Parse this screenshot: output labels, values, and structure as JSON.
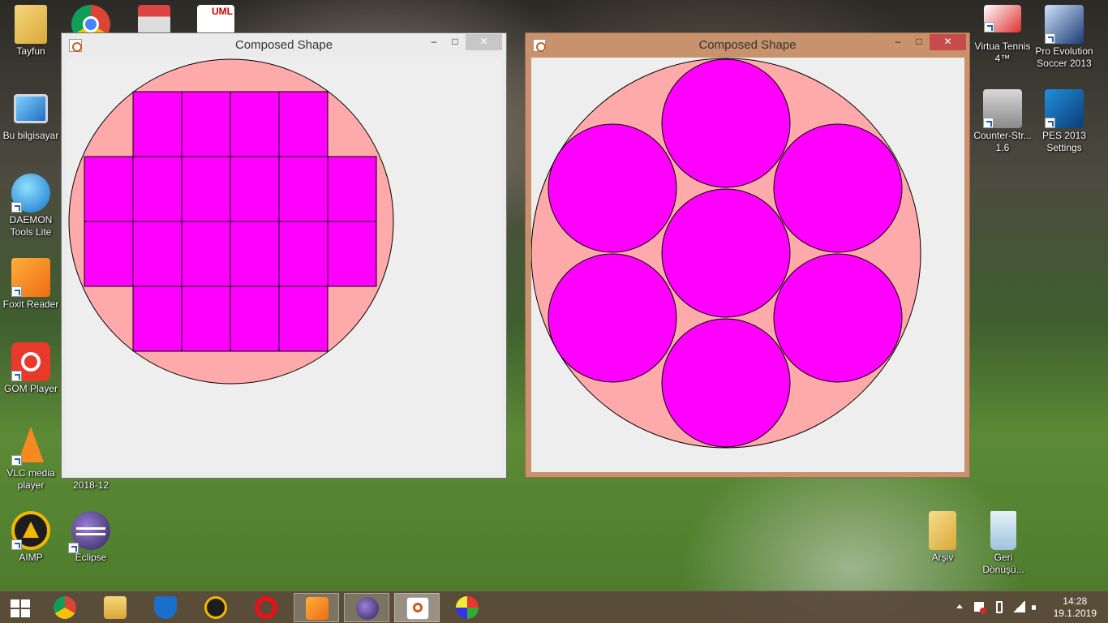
{
  "desktop": {
    "left_icons": [
      {
        "label": "Tayfun",
        "icon": "user-folder-icon"
      },
      {
        "label": "Bu bilgisayar",
        "icon": "computer-icon"
      },
      {
        "label": "DAEMON\nTools Lite",
        "icon": "daemon-tools-icon"
      },
      {
        "label": "Foxit Reader",
        "icon": "foxit-reader-icon"
      },
      {
        "label": "GOM Player",
        "icon": "gom-player-icon"
      },
      {
        "label": "VLC media\nplayer",
        "icon": "vlc-icon"
      },
      {
        "label": "AIMP",
        "icon": "aimp-icon"
      }
    ],
    "second_column_icons": [
      {
        "label": "2018-12",
        "icon": "folder-icon"
      },
      {
        "label": "Eclipse",
        "icon": "eclipse-icon"
      }
    ],
    "right_icons": [
      {
        "label": "Virtua Tennis\n4™",
        "icon": "virtua-tennis-icon"
      },
      {
        "label": "Pro Evolution\nSoccer 2013",
        "icon": "pes-2013-icon"
      },
      {
        "label": "Counter-Str...\n1.6",
        "icon": "counter-strike-icon"
      },
      {
        "label": "PES 2013\nSettings",
        "icon": "pes-settings-icon"
      },
      {
        "label": "Arşiv",
        "icon": "archive-folder-icon"
      },
      {
        "label": "Geri\nDönüşü...",
        "icon": "recycle-bin-icon"
      }
    ]
  },
  "windows": [
    {
      "title": "Composed Shape",
      "minimize_label": "–",
      "maximize_label": "□",
      "close_label": "✕",
      "active": false,
      "container": {
        "shape": "circle",
        "fill": "#ffaaaa"
      },
      "inner_shape": "rectangle",
      "inner_fill": "#ff00ff",
      "inner_count": 24
    },
    {
      "title": "Composed Shape",
      "minimize_label": "–",
      "maximize_label": "□",
      "close_label": "✕",
      "active": true,
      "container": {
        "shape": "circle",
        "fill": "#ffaaaa"
      },
      "inner_shape": "circle",
      "inner_fill": "#ff00ff",
      "inner_count": 7
    }
  ],
  "taskbar": {
    "start_icon": "windows-start-icon",
    "pinned": [
      {
        "icon": "chrome-icon",
        "active": false
      },
      {
        "icon": "file-explorer-icon",
        "active": false
      },
      {
        "icon": "windows-defender-icon",
        "active": false
      },
      {
        "icon": "aimp-icon",
        "active": false
      },
      {
        "icon": "opera-icon",
        "active": false
      },
      {
        "icon": "foxit-reader-icon",
        "active": false
      },
      {
        "icon": "eclipse-icon",
        "active": true
      },
      {
        "icon": "java-icon",
        "active": true
      },
      {
        "icon": "paint-icon",
        "active": false
      }
    ],
    "tray_icons": [
      "show-hidden-icons-chevron",
      "action-center-flag-icon",
      "battery-icon",
      "signal-icon",
      "volume-icon"
    ],
    "time": "14:28",
    "date": "19.1.2019"
  },
  "colors": {
    "container_fill": "#ffaaaa",
    "shape_fill": "#ff00ff",
    "client_bg": "#eeeeee",
    "active_frame": "#c8926d",
    "inactive_frame": "#ebebeb",
    "close_active": "#c74b4b",
    "close_inactive": "#c7c7c7"
  }
}
